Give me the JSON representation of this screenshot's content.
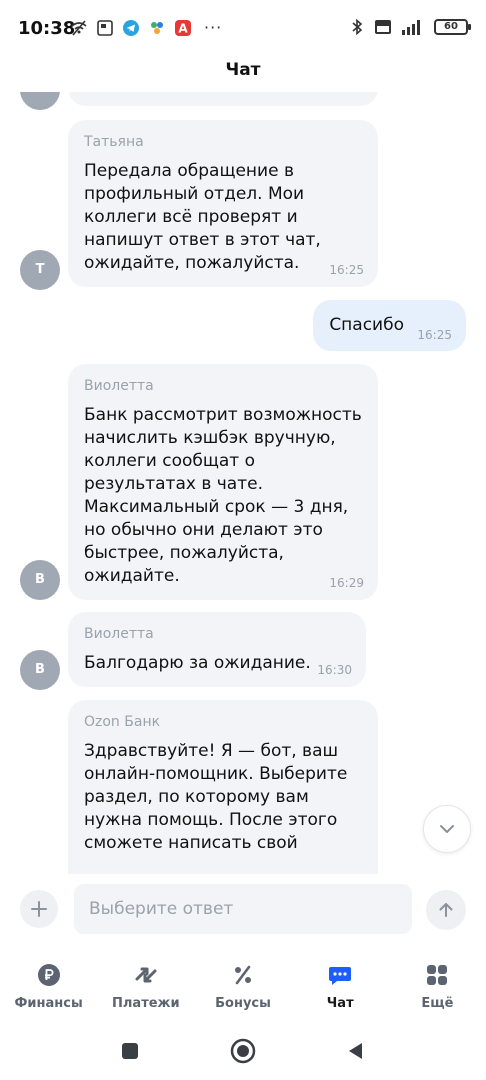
{
  "status_bar": {
    "time": "10:38",
    "battery": "60",
    "left_icons": [
      "no-wifi-icon",
      "notification-icon",
      "telegram-icon",
      "app-icon",
      "alert-app-icon"
    ],
    "right_icons": [
      "bluetooth-icon",
      "volte-icon",
      "signal-icon"
    ]
  },
  "header": {
    "title": "Чат"
  },
  "messages": [
    {
      "sender": "Татьяна",
      "avatar_letter": "Т",
      "text": "Передала обращение в профильный отдел. Мои коллеги всё проверят и напишут ответ в этот чат, ожидайте, пожалуйста.",
      "time": "16:25"
    },
    {
      "text": "Спасибо",
      "time": "16:25"
    },
    {
      "sender": "Виолетта",
      "avatar_letter": "В",
      "text": "Банк рассмотрит возможность начислить кэшбэк вручную, коллеги сообщат о результатах в чате. Максимальный срок — 3 дня, но обычно они делают это быстрее, пожалуйста, ожидайте.",
      "time": "16:29"
    },
    {
      "sender": "Виолетта",
      "avatar_letter": "В",
      "text": "Балгодарю за ожидание.",
      "time": "16:30"
    },
    {
      "sender": "Ozon Банк",
      "text": "Здравствуйте! Я — бот, ваш онлайн-помощник. Выберите раздел, по которому вам нужна помощь. После этого сможете написать свой"
    }
  ],
  "input": {
    "placeholder": "Выберите ответ"
  },
  "nav": [
    {
      "label": "Финансы",
      "icon": "ruble-icon"
    },
    {
      "label": "Платежи",
      "icon": "transfer-arrows-icon"
    },
    {
      "label": "Бонусы",
      "icon": "percent-icon"
    },
    {
      "label": "Чат",
      "icon": "chat-bubble-icon",
      "active": true
    },
    {
      "label": "Ещё",
      "icon": "grid-icon"
    }
  ],
  "colors": {
    "accent": "#1e5eff",
    "bubble_in": "#f2f4f7",
    "bubble_out": "#e6f0fc",
    "avatar": "#a0a8b3",
    "muted_text": "#9aa2ad"
  }
}
